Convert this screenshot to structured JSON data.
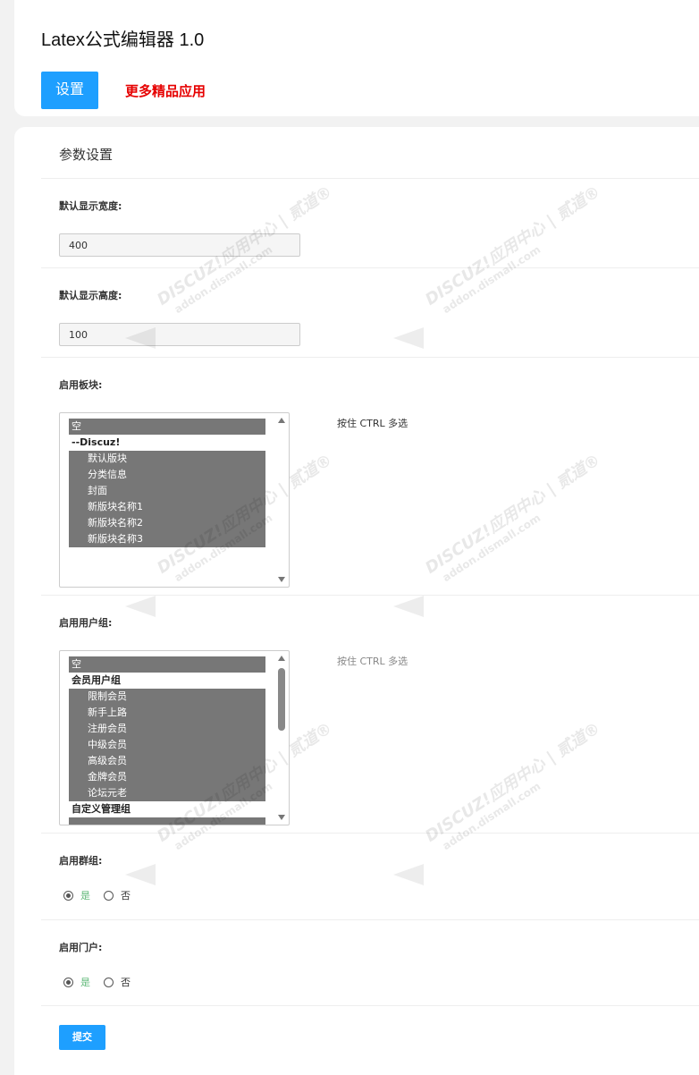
{
  "header": {
    "title": "Latex公式编辑器 1.0",
    "settings_button": "设置",
    "more_apps_link": "更多精品应用"
  },
  "form": {
    "section_title": "参数设置",
    "width": {
      "label": "默认显示宽度:",
      "value": "400"
    },
    "height": {
      "label": "默认显示高度:",
      "value": "100"
    },
    "forums": {
      "label": "启用板块:",
      "hint": "按住 CTRL 多选",
      "options": [
        {
          "text": "空",
          "kind": "option"
        },
        {
          "text": "--Discuz!",
          "kind": "group"
        },
        {
          "text": "默认版块",
          "kind": "child"
        },
        {
          "text": "分类信息",
          "kind": "child"
        },
        {
          "text": "封面",
          "kind": "child"
        },
        {
          "text": "新版块名称1",
          "kind": "child"
        },
        {
          "text": "新版块名称2",
          "kind": "child"
        },
        {
          "text": "新版块名称3",
          "kind": "child"
        }
      ]
    },
    "usergroups": {
      "label": "启用用户组:",
      "hint": "按住 CTRL 多选",
      "options": [
        {
          "text": "空",
          "kind": "option"
        },
        {
          "text": "会员用户组",
          "kind": "group"
        },
        {
          "text": "限制会员",
          "kind": "child"
        },
        {
          "text": "新手上路",
          "kind": "child"
        },
        {
          "text": "注册会员",
          "kind": "child"
        },
        {
          "text": "中级会员",
          "kind": "child"
        },
        {
          "text": "高级会员",
          "kind": "child"
        },
        {
          "text": "金牌会员",
          "kind": "child"
        },
        {
          "text": "论坛元老",
          "kind": "child"
        },
        {
          "text": "自定义管理组",
          "kind": "group"
        }
      ]
    },
    "groups": {
      "label": "启用群组:",
      "yes": "是",
      "no": "否",
      "selected": "是"
    },
    "portal": {
      "label": "启用门户:",
      "yes": "是",
      "no": "否",
      "selected": "是"
    },
    "submit": "提交"
  },
  "watermark": {
    "line1": "DISCUZ!应用中心 | 贰道®",
    "line2": "addon.dismall.com"
  }
}
